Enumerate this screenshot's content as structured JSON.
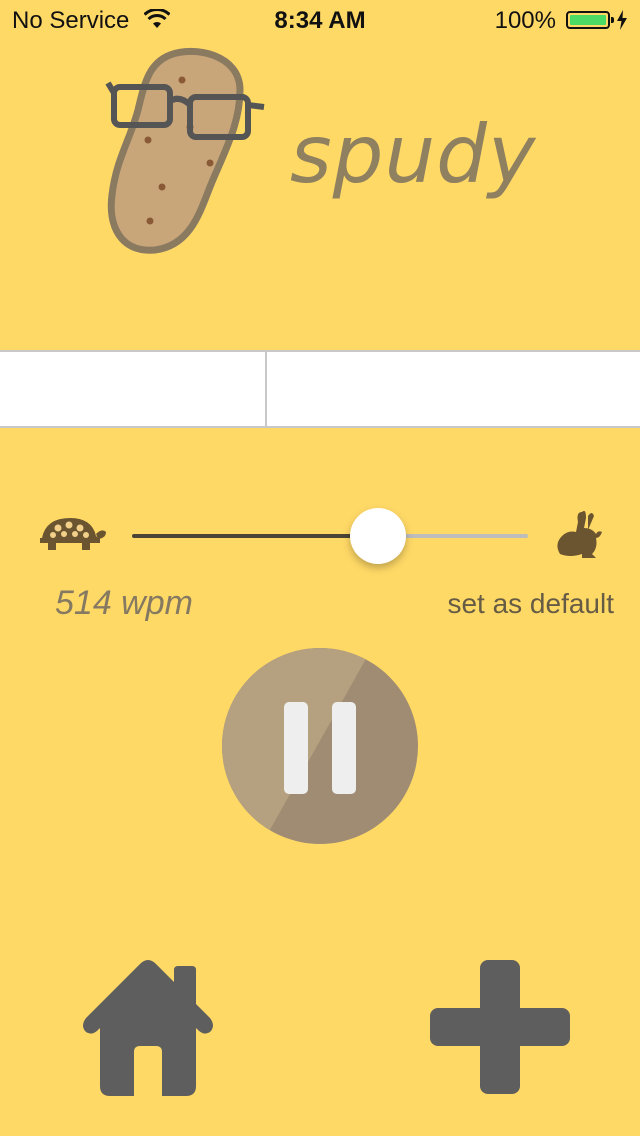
{
  "status_bar": {
    "carrier": "No Service",
    "time": "8:34 AM",
    "battery_percent": "100%",
    "icons": [
      "wifi-icon",
      "battery-icon",
      "charging-bolt-icon"
    ]
  },
  "app": {
    "name": "spudy",
    "logo_icon": "potato-with-glasses-icon"
  },
  "speed": {
    "value": 514,
    "label": "514 wpm",
    "slider_fraction": 0.62,
    "slow_icon": "turtle-icon",
    "fast_icon": "rabbit-icon",
    "set_default_label": "set as default"
  },
  "controls": {
    "play_state": "playing",
    "pause_icon": "pause-icon",
    "home_icon": "home-icon",
    "add_icon": "plus-icon"
  },
  "colors": {
    "background": "#FFD966",
    "panel": "#FFFFFF",
    "pause_button": "#A08C72",
    "nav_icons": "#5E5E5E",
    "battery": "#4CD964"
  }
}
